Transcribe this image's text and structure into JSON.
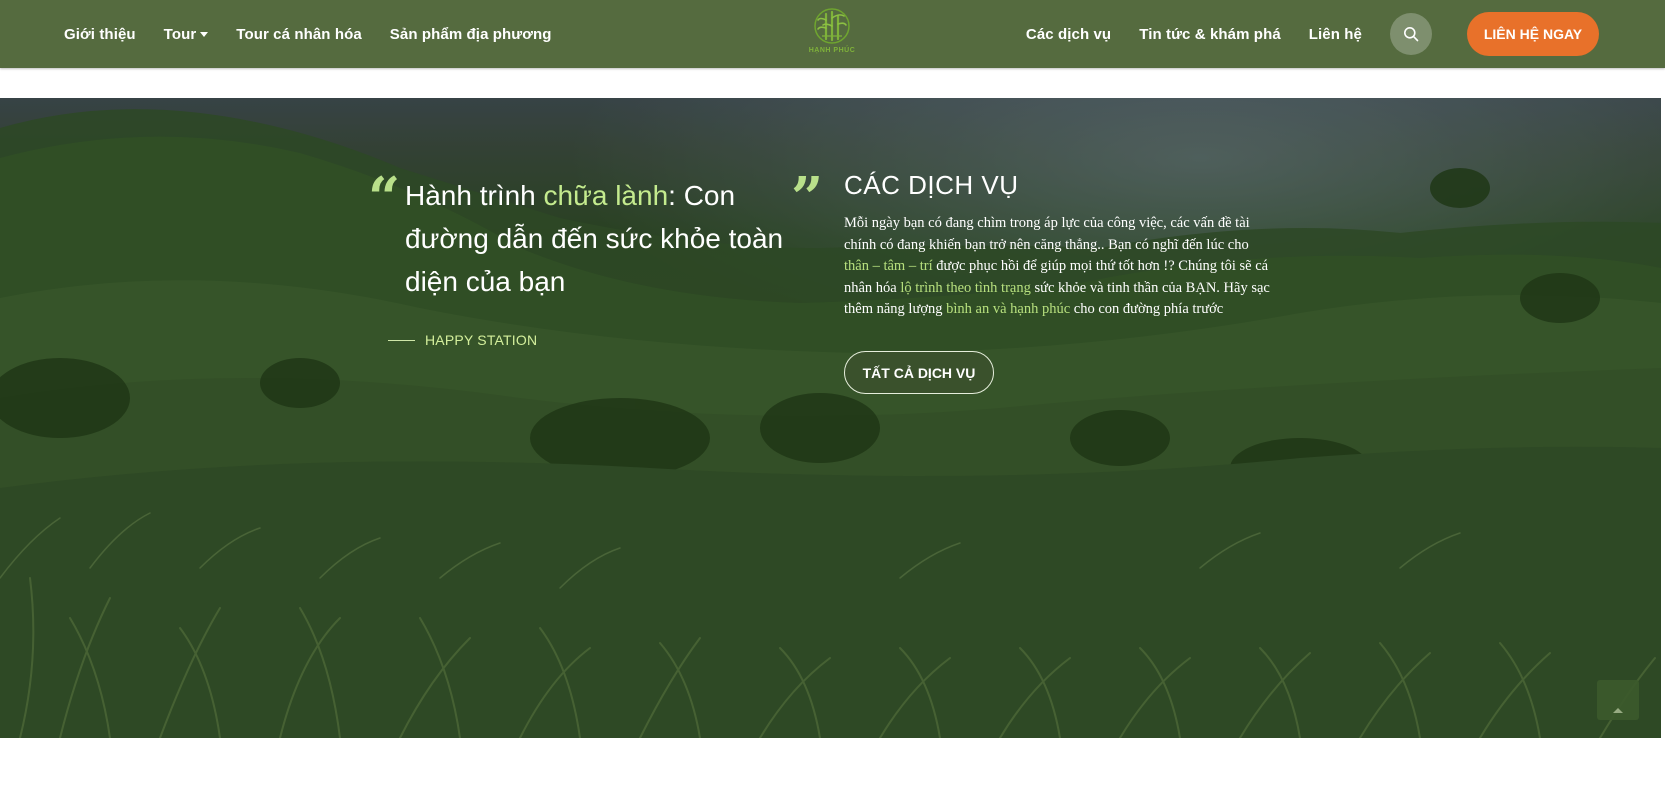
{
  "nav": {
    "left_items": [
      {
        "label": "Giới thiệu"
      },
      {
        "label": "Tour",
        "has_dropdown": true
      },
      {
        "label": "Tour cá nhân hóa"
      },
      {
        "label": "Sản phẩm địa phương"
      }
    ],
    "right_items": [
      {
        "label": "Các dịch vụ"
      },
      {
        "label": "Tin tức & khám phá"
      },
      {
        "label": "Liên hệ"
      }
    ],
    "logo_text": "HẠNH PHÚC",
    "search_icon": "search-icon",
    "cta_label": "LIÊN HỆ NGAY"
  },
  "hero": {
    "quote": {
      "part1": "Hành trình ",
      "highlight": "chữa lành",
      "part2": ": Con đường dẫn đến sức khỏe toàn diện của bạn",
      "author": "HAPPY STATION"
    },
    "services": {
      "title": "CÁC DỊCH VỤ",
      "desc_1": "Mỗi ngày bạn có đang chìm trong áp lực của công việc, các vấn đề tài chính có đang khiến bạn trở nên căng thẳng.. Bạn có nghĩ đến lúc cho ",
      "hl_1": "thân – tâm – trí",
      "desc_2": " được phục hồi để giúp mọi thứ tốt hơn !? Chúng tôi sẽ cá nhân hóa ",
      "hl_2": "lộ trình theo tình trạng",
      "desc_3": " sức khỏe và tinh thần của BẠN. Hãy sạc thêm năng lượng ",
      "hl_3": "bình an và hạnh phúc",
      "desc_4": " cho con đường phía trước",
      "button_label": "TẤT CẢ DỊCH VỤ"
    }
  },
  "scroll_top_icon": "arrow-up-icon",
  "colors": {
    "navbar": "#556b3f",
    "cta": "#e8712a",
    "highlight": "#c4eb8e"
  }
}
